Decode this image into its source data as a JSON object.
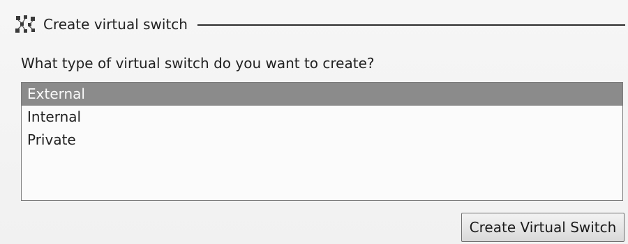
{
  "section": {
    "title": "Create virtual switch",
    "icon": "virtual-switch-icon"
  },
  "question": "What type of virtual switch do you want to create?",
  "switch_types": {
    "items": [
      {
        "label": "External",
        "selected": true
      },
      {
        "label": "Internal",
        "selected": false
      },
      {
        "label": "Private",
        "selected": false
      }
    ],
    "selected_value": "External"
  },
  "actions": {
    "create_label": "Create Virtual Switch"
  },
  "colors": {
    "background": "#f4f4f4",
    "selection": "#8b8b8b",
    "rule": "#2b2b2b"
  }
}
